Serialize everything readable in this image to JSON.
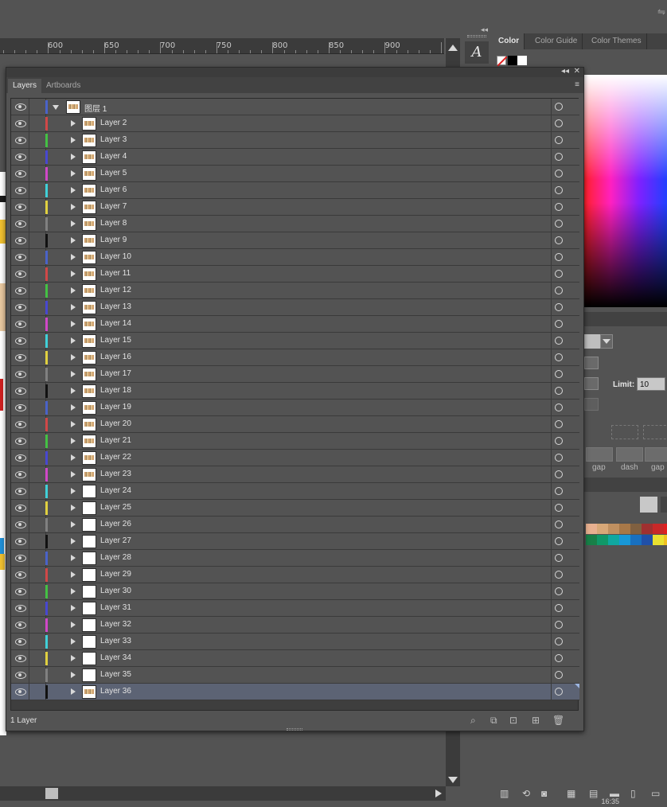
{
  "topbar": {
    "extra_icon": "⇋"
  },
  "ruler": {
    "labels": [
      "600",
      "650",
      "700",
      "750",
      "800",
      "850",
      "900"
    ]
  },
  "toolstrip": {
    "type_tool_glyph": "A"
  },
  "color_panel": {
    "tabs": [
      "Color",
      "Color Guide",
      "Color Themes"
    ],
    "active_tab": "Color"
  },
  "stroke_panel": {
    "limit_label": "Limit:",
    "limit_value": "10",
    "dash_labels": [
      "gap",
      "dash",
      "gap"
    ]
  },
  "layers_panel": {
    "tabs": [
      "Layers",
      "Artboards"
    ],
    "active_tab": "Layers",
    "menu_icon": "≡",
    "collapse_icon": "◂◂",
    "close_icon": "✕",
    "top_layer": {
      "name": "图层 1",
      "color": "#4a63c8"
    },
    "sublayers": [
      {
        "name": "Layer 2",
        "color": "#d04848",
        "thumb": "art"
      },
      {
        "name": "Layer 3",
        "color": "#44c044",
        "thumb": "art"
      },
      {
        "name": "Layer 4",
        "color": "#4848d0",
        "thumb": "art"
      },
      {
        "name": "Layer 5",
        "color": "#d048c8",
        "thumb": "art"
      },
      {
        "name": "Layer 6",
        "color": "#40d0d8",
        "thumb": "art"
      },
      {
        "name": "Layer 7",
        "color": "#e0d040",
        "thumb": "art"
      },
      {
        "name": "Layer 8",
        "color": "#808080",
        "thumb": "art"
      },
      {
        "name": "Layer 9",
        "color": "#111111",
        "thumb": "art"
      },
      {
        "name": "Layer 10",
        "color": "#4a63c8",
        "thumb": "art"
      },
      {
        "name": "Layer 11",
        "color": "#d04848",
        "thumb": "art"
      },
      {
        "name": "Layer 12",
        "color": "#44c044",
        "thumb": "art"
      },
      {
        "name": "Layer 13",
        "color": "#4848d0",
        "thumb": "art"
      },
      {
        "name": "Layer 14",
        "color": "#d048c8",
        "thumb": "art"
      },
      {
        "name": "Layer 15",
        "color": "#40d0d8",
        "thumb": "art"
      },
      {
        "name": "Layer 16",
        "color": "#e0d040",
        "thumb": "art"
      },
      {
        "name": "Layer 17",
        "color": "#808080",
        "thumb": "art"
      },
      {
        "name": "Layer 18",
        "color": "#111111",
        "thumb": "art"
      },
      {
        "name": "Layer 19",
        "color": "#4a63c8",
        "thumb": "art"
      },
      {
        "name": "Layer 20",
        "color": "#d04848",
        "thumb": "art"
      },
      {
        "name": "Layer 21",
        "color": "#44c044",
        "thumb": "art"
      },
      {
        "name": "Layer 22",
        "color": "#4848d0",
        "thumb": "art"
      },
      {
        "name": "Layer 23",
        "color": "#d048c8",
        "thumb": "art"
      },
      {
        "name": "Layer 24",
        "color": "#40d0d8",
        "thumb": "blank"
      },
      {
        "name": "Layer 25",
        "color": "#e0d040",
        "thumb": "blank"
      },
      {
        "name": "Layer 26",
        "color": "#808080",
        "thumb": "blank"
      },
      {
        "name": "Layer 27",
        "color": "#111111",
        "thumb": "blank"
      },
      {
        "name": "Layer 28",
        "color": "#4a63c8",
        "thumb": "blank"
      },
      {
        "name": "Layer 29",
        "color": "#d04848",
        "thumb": "blank"
      },
      {
        "name": "Layer 30",
        "color": "#44c044",
        "thumb": "blank"
      },
      {
        "name": "Layer 31",
        "color": "#4848d0",
        "thumb": "blank"
      },
      {
        "name": "Layer 32",
        "color": "#d048c8",
        "thumb": "blank"
      },
      {
        "name": "Layer 33",
        "color": "#40d0d8",
        "thumb": "blank"
      },
      {
        "name": "Layer 34",
        "color": "#e0d040",
        "thumb": "blank"
      },
      {
        "name": "Layer 35",
        "color": "#808080",
        "thumb": "blank"
      },
      {
        "name": "Layer 36",
        "color": "#111111",
        "thumb": "art",
        "selected": true
      }
    ],
    "footer": {
      "count_label": "1 Layer",
      "icons": [
        "search-icon",
        "collect-icon",
        "make-clipping-mask-icon",
        "new-sublayer-icon",
        "new-layer-icon",
        "delete-icon"
      ]
    }
  },
  "swatch_colors": [
    "#e8b090",
    "#d8a878",
    "#c09060",
    "#a87848",
    "#806040",
    "#a03030",
    "#c82828",
    "#e02020",
    "#188048",
    "#109868",
    "#10a8a0",
    "#1898d8",
    "#1870c0",
    "#2050a8",
    "#e8e030",
    "#f0c020"
  ],
  "dock_icons": [
    "library-icon",
    "share-icon",
    "camera-icon",
    "grid-icon",
    "doc-icon",
    "folder-icon",
    "new-icon",
    "trash-icon"
  ],
  "clock_text": "16:35"
}
